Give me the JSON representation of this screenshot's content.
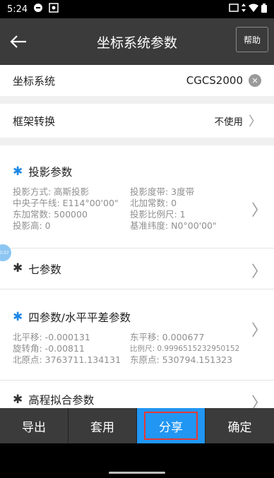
{
  "status_bar": {
    "time": "5:24"
  },
  "app_bar": {
    "title": "坐标系统参数",
    "help_label": "帮助"
  },
  "coord_system": {
    "label": "坐标系统",
    "value": "CGCS2000"
  },
  "frame_transform": {
    "label": "框架转换",
    "value": "不使用"
  },
  "projection": {
    "title": "投影参数",
    "params": [
      "投影方式: 高斯投影",
      "投影度带: 3度带",
      "中央子午线: E114°00'00\"",
      "北加常数: 0",
      "东加常数: 500000",
      "投影比例尺: 1",
      "投影高: 0",
      "基准纬度: N0°00'00\""
    ]
  },
  "float_badge": "00:37",
  "seven_params": {
    "title": "七参数"
  },
  "four_params": {
    "title": "四参数/水平平差参数",
    "params": [
      "北平移: -0.000131",
      "东平移: 0.000677",
      "旋转角: -0.00811",
      "比例尺: 0.9996515232950152",
      "北原点: 3763711.134131",
      "东原点: 530794.151323"
    ]
  },
  "height_fit": {
    "title": "高程拟合参数"
  },
  "bottom_bar": {
    "export": "导出",
    "apply": "套用",
    "share": "分享",
    "confirm": "确定"
  },
  "colors": {
    "accent": "#2196f3",
    "app_bar": "#3b3b3b",
    "highlight": "#e53935"
  }
}
